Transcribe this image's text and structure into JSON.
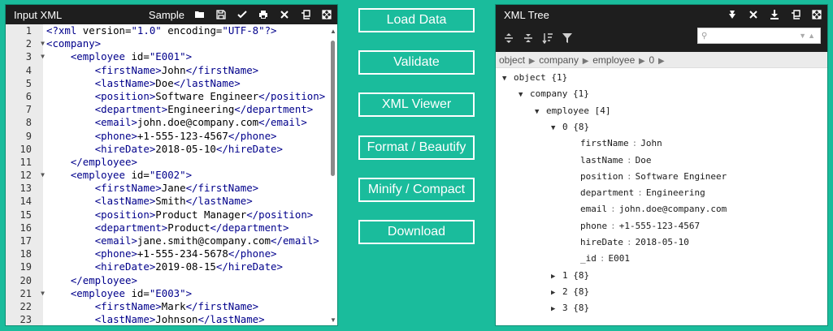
{
  "left": {
    "title": "Input XML",
    "sample_label": "Sample",
    "lines": [
      {
        "n": "1",
        "fold": "",
        "indent": 0,
        "tokens": [
          [
            "tag",
            "<?xml"
          ],
          [
            "txt",
            " version="
          ],
          [
            "str",
            "\"1.0\""
          ],
          [
            "txt",
            " encoding="
          ],
          [
            "str",
            "\"UTF-8\""
          ],
          [
            "tag",
            "?>"
          ]
        ]
      },
      {
        "n": "2",
        "fold": "▼",
        "indent": 0,
        "tokens": [
          [
            "tag",
            "<company>"
          ]
        ]
      },
      {
        "n": "3",
        "fold": "▼",
        "indent": 1,
        "tokens": [
          [
            "tag",
            "<employee"
          ],
          [
            "txt",
            " id="
          ],
          [
            "str",
            "\"E001\""
          ],
          [
            "tag",
            ">"
          ]
        ]
      },
      {
        "n": "4",
        "fold": "",
        "indent": 2,
        "tokens": [
          [
            "tag",
            "<firstName>"
          ],
          [
            "txt",
            "John"
          ],
          [
            "tag",
            "</firstName>"
          ]
        ]
      },
      {
        "n": "5",
        "fold": "",
        "indent": 2,
        "tokens": [
          [
            "tag",
            "<lastName>"
          ],
          [
            "txt",
            "Doe"
          ],
          [
            "tag",
            "</lastName>"
          ]
        ]
      },
      {
        "n": "6",
        "fold": "",
        "indent": 2,
        "tokens": [
          [
            "tag",
            "<position>"
          ],
          [
            "txt",
            "Software Engineer"
          ],
          [
            "tag",
            "</position>"
          ]
        ]
      },
      {
        "n": "7",
        "fold": "",
        "indent": 2,
        "tokens": [
          [
            "tag",
            "<department>"
          ],
          [
            "txt",
            "Engineering"
          ],
          [
            "tag",
            "</department>"
          ]
        ]
      },
      {
        "n": "8",
        "fold": "",
        "indent": 2,
        "tokens": [
          [
            "tag",
            "<email>"
          ],
          [
            "txt",
            "john.doe@company.com"
          ],
          [
            "tag",
            "</email>"
          ]
        ]
      },
      {
        "n": "9",
        "fold": "",
        "indent": 2,
        "tokens": [
          [
            "tag",
            "<phone>"
          ],
          [
            "txt",
            "+1-555-123-4567"
          ],
          [
            "tag",
            "</phone>"
          ]
        ]
      },
      {
        "n": "10",
        "fold": "",
        "indent": 2,
        "tokens": [
          [
            "tag",
            "<hireDate>"
          ],
          [
            "txt",
            "2018-05-10"
          ],
          [
            "tag",
            "</hireDate>"
          ]
        ]
      },
      {
        "n": "11",
        "fold": "",
        "indent": 1,
        "tokens": [
          [
            "tag",
            "</employee>"
          ]
        ]
      },
      {
        "n": "12",
        "fold": "▼",
        "indent": 1,
        "tokens": [
          [
            "tag",
            "<employee"
          ],
          [
            "txt",
            " id="
          ],
          [
            "str",
            "\"E002\""
          ],
          [
            "tag",
            ">"
          ]
        ]
      },
      {
        "n": "13",
        "fold": "",
        "indent": 2,
        "tokens": [
          [
            "tag",
            "<firstName>"
          ],
          [
            "txt",
            "Jane"
          ],
          [
            "tag",
            "</firstName>"
          ]
        ]
      },
      {
        "n": "14",
        "fold": "",
        "indent": 2,
        "tokens": [
          [
            "tag",
            "<lastName>"
          ],
          [
            "txt",
            "Smith"
          ],
          [
            "tag",
            "</lastName>"
          ]
        ]
      },
      {
        "n": "15",
        "fold": "",
        "indent": 2,
        "tokens": [
          [
            "tag",
            "<position>"
          ],
          [
            "txt",
            "Product Manager"
          ],
          [
            "tag",
            "</position>"
          ]
        ]
      },
      {
        "n": "16",
        "fold": "",
        "indent": 2,
        "tokens": [
          [
            "tag",
            "<department>"
          ],
          [
            "txt",
            "Product"
          ],
          [
            "tag",
            "</department>"
          ]
        ]
      },
      {
        "n": "17",
        "fold": "",
        "indent": 2,
        "tokens": [
          [
            "tag",
            "<email>"
          ],
          [
            "txt",
            "jane.smith@company.com"
          ],
          [
            "tag",
            "</email>"
          ]
        ]
      },
      {
        "n": "18",
        "fold": "",
        "indent": 2,
        "tokens": [
          [
            "tag",
            "<phone>"
          ],
          [
            "txt",
            "+1-555-234-5678"
          ],
          [
            "tag",
            "</phone>"
          ]
        ]
      },
      {
        "n": "19",
        "fold": "",
        "indent": 2,
        "tokens": [
          [
            "tag",
            "<hireDate>"
          ],
          [
            "txt",
            "2019-08-15"
          ],
          [
            "tag",
            "</hireDate>"
          ]
        ]
      },
      {
        "n": "20",
        "fold": "",
        "indent": 1,
        "tokens": [
          [
            "tag",
            "</employee>"
          ]
        ]
      },
      {
        "n": "21",
        "fold": "▼",
        "indent": 1,
        "tokens": [
          [
            "tag",
            "<employee"
          ],
          [
            "txt",
            " id="
          ],
          [
            "str",
            "\"E003\""
          ],
          [
            "tag",
            ">"
          ]
        ]
      },
      {
        "n": "22",
        "fold": "",
        "indent": 2,
        "tokens": [
          [
            "tag",
            "<firstName>"
          ],
          [
            "txt",
            "Mark"
          ],
          [
            "tag",
            "</firstName>"
          ]
        ]
      },
      {
        "n": "23",
        "fold": "",
        "indent": 2,
        "tokens": [
          [
            "tag",
            "<lastName>"
          ],
          [
            "txt",
            "Johnson"
          ],
          [
            "tag",
            "</lastName>"
          ]
        ]
      }
    ]
  },
  "middle": {
    "buttons": [
      "Load Data",
      "Validate",
      "XML Viewer",
      "Format / Beautify",
      "Minify / Compact",
      "Download"
    ]
  },
  "right": {
    "title": "XML Tree",
    "search_placeholder": "",
    "breadcrumb": [
      "object",
      "company",
      "employee",
      "0"
    ],
    "tree": [
      {
        "depth": 0,
        "toggle": "▼",
        "text": "object {1}"
      },
      {
        "depth": 1,
        "toggle": "▼",
        "text": "company {1}"
      },
      {
        "depth": 2,
        "toggle": "▼",
        "text": "employee [4]"
      },
      {
        "depth": 3,
        "toggle": "▼",
        "text": "0 {8}"
      },
      {
        "depth": 4,
        "toggle": "",
        "key": "firstName",
        "value": "John"
      },
      {
        "depth": 4,
        "toggle": "",
        "key": "lastName",
        "value": "Doe"
      },
      {
        "depth": 4,
        "toggle": "",
        "key": "position",
        "value": "Software Engineer"
      },
      {
        "depth": 4,
        "toggle": "",
        "key": "department",
        "value": "Engineering"
      },
      {
        "depth": 4,
        "toggle": "",
        "key": "email",
        "value": "john.doe@company.com"
      },
      {
        "depth": 4,
        "toggle": "",
        "key": "phone",
        "value": "+1-555-123-4567"
      },
      {
        "depth": 4,
        "toggle": "",
        "key": "hireDate",
        "value": "2018-05-10"
      },
      {
        "depth": 4,
        "toggle": "",
        "key": "_id",
        "value": "E001"
      },
      {
        "depth": 3,
        "toggle": "▶",
        "text": "1 {8}"
      },
      {
        "depth": 3,
        "toggle": "▶",
        "text": "2 {8}"
      },
      {
        "depth": 3,
        "toggle": "▶",
        "text": "3 {8}"
      }
    ]
  },
  "colors": {
    "background": "#1abc9c",
    "header": "#1e1e1e",
    "tag": "#00008b"
  }
}
